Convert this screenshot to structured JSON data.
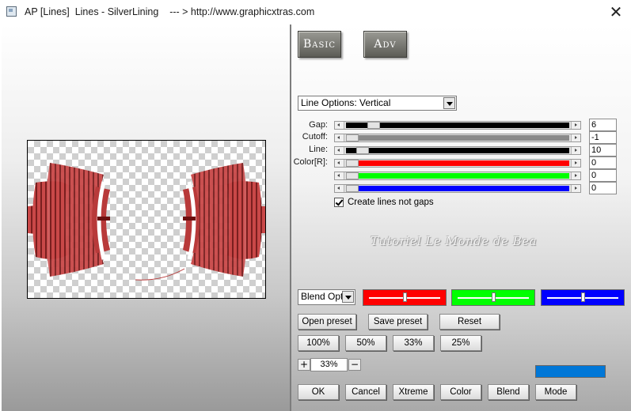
{
  "window": {
    "title": "AP [Lines]  Lines - SilverLining    --- > http://www.graphicxtras.com",
    "close_glyph": "✕"
  },
  "tabs": [
    {
      "label": "Basic"
    },
    {
      "label": "Adv"
    }
  ],
  "line_options": {
    "selected": "Line Options: Vertical"
  },
  "sliders": [
    {
      "label": "Gap:",
      "value": "6",
      "fill": "#000000",
      "position": 0.1
    },
    {
      "label": "Cutoff:",
      "value": "-1",
      "fill": "#8a8a8a",
      "position": 0.0
    },
    {
      "label": "Line:",
      "value": "10",
      "fill": "#000000",
      "position": 0.05
    },
    {
      "label": "Color[R]:",
      "value": "0",
      "fill": "#ff0000",
      "position": 0.0
    },
    {
      "label": "",
      "value": "0",
      "fill": "#00ff00",
      "position": 0.0
    },
    {
      "label": "",
      "value": "0",
      "fill": "#0000ff",
      "position": 0.0
    }
  ],
  "create_lines_checkbox": {
    "label": "Create lines not gaps",
    "checked": true
  },
  "watermark": "Tutoriel Le Monde de Bea",
  "blend": {
    "selected": "Blend Options",
    "sliders": [
      {
        "color": "#ff0000",
        "position": 0.5
      },
      {
        "color": "#00ff00",
        "position": 0.5
      },
      {
        "color": "#0000ff",
        "position": 0.5
      }
    ]
  },
  "preset_buttons": {
    "open": "Open preset",
    "save": "Save preset",
    "reset": "Reset"
  },
  "zoom_buttons": [
    "100%",
    "50%",
    "33%",
    "25%"
  ],
  "zoom": {
    "plus": "+",
    "value": "33%",
    "minus": "−"
  },
  "color_swatch": "#0077d7",
  "bottom_buttons": [
    "OK",
    "Cancel",
    "Xtreme",
    "Color",
    "Blend",
    "Mode"
  ]
}
